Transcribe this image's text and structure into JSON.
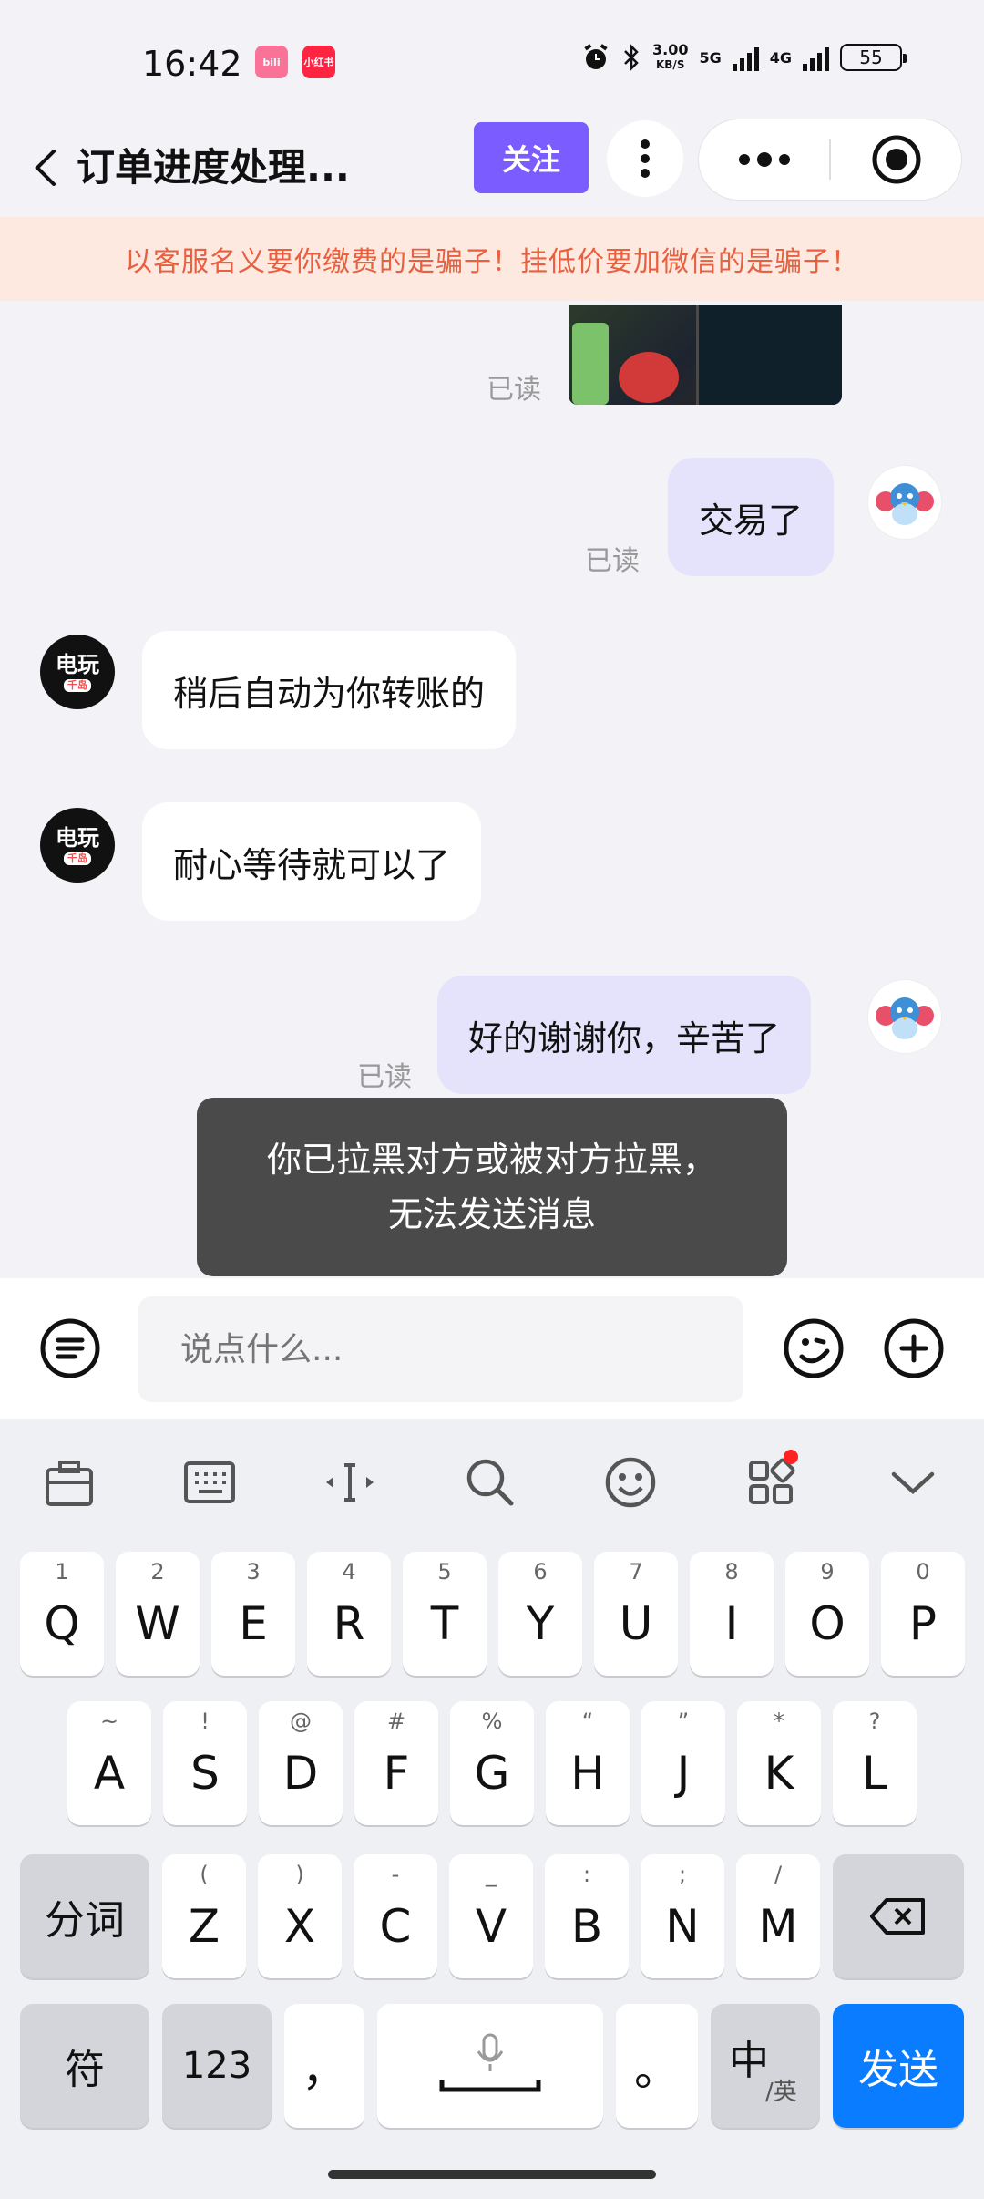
{
  "status_bar": {
    "time": "16:42",
    "app1": "bili",
    "app2": "小红书",
    "net_speed_value": "3.00",
    "net_speed_unit": "KB/S",
    "net1": "5G",
    "net2": "4G",
    "battery": "55"
  },
  "header": {
    "title": "订单进度处理...",
    "follow_label": "关注"
  },
  "warning": "以客服名义要你缴费的是骗子！挂低价要加微信的是骗子！",
  "chat": {
    "messages": [
      {
        "read_label": "已读"
      },
      {
        "text": "交易了",
        "read_label": "已读"
      },
      {
        "text": "稍后自动为你转账的",
        "avatar_text": "电玩",
        "avatar_sub": "千岛"
      },
      {
        "text": "耐心等待就可以了",
        "avatar_text": "电玩",
        "avatar_sub": "千岛"
      },
      {
        "text": "好的谢谢你，辛苦了",
        "read_label": "已读"
      }
    ]
  },
  "toast": "你已拉黑对方或被对方拉黑，无法发送消息",
  "input": {
    "placeholder": "说点什么..."
  },
  "keyboard": {
    "row1": [
      {
        "sub": "1",
        "main": "Q"
      },
      {
        "sub": "2",
        "main": "W"
      },
      {
        "sub": "3",
        "main": "E"
      },
      {
        "sub": "4",
        "main": "R"
      },
      {
        "sub": "5",
        "main": "T"
      },
      {
        "sub": "6",
        "main": "Y"
      },
      {
        "sub": "7",
        "main": "U"
      },
      {
        "sub": "8",
        "main": "I"
      },
      {
        "sub": "9",
        "main": "O"
      },
      {
        "sub": "0",
        "main": "P"
      }
    ],
    "row2": [
      {
        "sub": "~",
        "main": "A"
      },
      {
        "sub": "!",
        "main": "S"
      },
      {
        "sub": "@",
        "main": "D"
      },
      {
        "sub": "#",
        "main": "F"
      },
      {
        "sub": "%",
        "main": "G"
      },
      {
        "sub": "“",
        "main": "H"
      },
      {
        "sub": "”",
        "main": "J"
      },
      {
        "sub": "*",
        "main": "K"
      },
      {
        "sub": "?",
        "main": "L"
      }
    ],
    "row3": [
      {
        "sub": "(",
        "main": "Z"
      },
      {
        "sub": ")",
        "main": "X"
      },
      {
        "sub": "-",
        "main": "C"
      },
      {
        "sub": "_",
        "main": "V"
      },
      {
        "sub": ":",
        "main": "B"
      },
      {
        "sub": ";",
        "main": "N"
      },
      {
        "sub": "/",
        "main": "M"
      }
    ],
    "segment_label": "分词",
    "symbol_label": "符",
    "num_label": "123",
    "comma_label": "，",
    "period_label": "。",
    "lang_main": "中",
    "lang_sub": "/英",
    "send_label": "发送"
  }
}
